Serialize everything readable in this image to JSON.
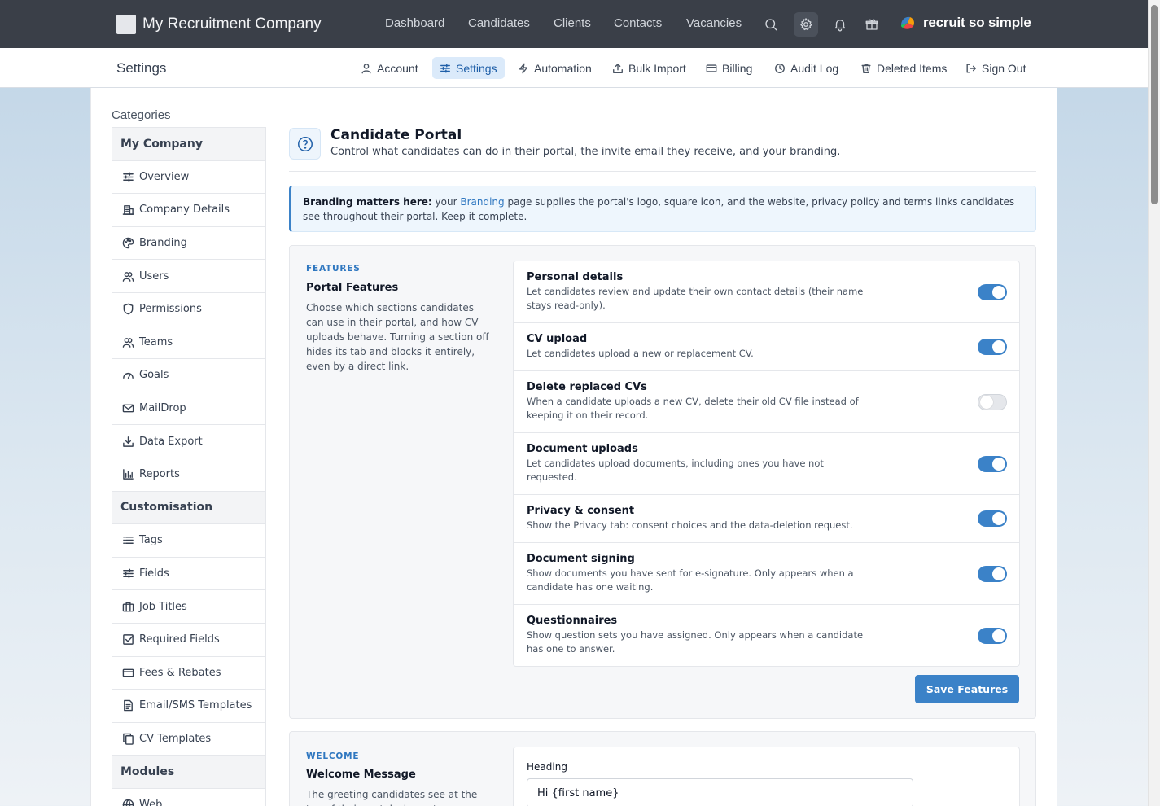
{
  "topbar": {
    "company_name": "My Recruitment Company",
    "nav": [
      "Dashboard",
      "Candidates",
      "Clients",
      "Contacts",
      "Vacancies"
    ],
    "brand_text": "recruit so simple"
  },
  "subbar": {
    "title": "Settings",
    "items": [
      {
        "label": "Account",
        "icon": "user-icon"
      },
      {
        "label": "Settings",
        "icon": "sliders-icon",
        "active": true
      },
      {
        "label": "Automation",
        "icon": "bolt-icon"
      },
      {
        "label": "Bulk Import",
        "icon": "upload-icon"
      },
      {
        "label": "Billing",
        "icon": "card-icon"
      },
      {
        "label": "Audit Log",
        "icon": "clock-icon"
      },
      {
        "label": "Deleted Items",
        "icon": "trash-icon"
      },
      {
        "label": "Sign Out",
        "icon": "sign-out-icon"
      }
    ]
  },
  "sidebar": {
    "categories_label": "Categories",
    "groups": [
      {
        "title": "My Company",
        "items": [
          "Overview",
          "Company Details",
          "Branding",
          "Users",
          "Permissions",
          "Teams",
          "Goals",
          "MailDrop",
          "Data Export",
          "Reports"
        ]
      },
      {
        "title": "Customisation",
        "items": [
          "Tags",
          "Fields",
          "Job Titles",
          "Required Fields",
          "Fees & Rebates",
          "Email/SMS Templates",
          "CV Templates"
        ]
      },
      {
        "title": "Modules",
        "items": [
          "Web"
        ]
      }
    ]
  },
  "header": {
    "title": "Candidate Portal",
    "subtitle": "Control what candidates can do in their portal, the invite email they receive, and your branding."
  },
  "notice": {
    "bold": "Branding matters here:",
    "pre": " your ",
    "link": "Branding",
    "post": " page supplies the portal's logo, square icon, and the website, privacy policy and terms links candidates see throughout their portal. Keep it complete."
  },
  "features": {
    "eyebrow": "FEATURES",
    "title": "Portal Features",
    "description": "Choose which sections candidates can use in their portal, and how CV uploads behave. Turning a section off hides its tab and blocks it entirely, even by a direct link.",
    "items": [
      {
        "title": "Personal details",
        "desc": "Let candidates review and update their own contact details (their name stays read-only).",
        "on": true
      },
      {
        "title": "CV upload",
        "desc": "Let candidates upload a new or replacement CV.",
        "on": true
      },
      {
        "title": "Delete replaced CVs",
        "desc": "When a candidate uploads a new CV, delete their old CV file instead of keeping it on their record.",
        "on": false
      },
      {
        "title": "Document uploads",
        "desc": "Let candidates upload documents, including ones you have not requested.",
        "on": true
      },
      {
        "title": "Privacy & consent",
        "desc": "Show the Privacy tab: consent choices and the data-deletion request.",
        "on": true
      },
      {
        "title": "Document signing",
        "desc": "Show documents you have sent for e-signature. Only appears when a candidate has one waiting.",
        "on": true
      },
      {
        "title": "Questionnaires",
        "desc": "Show question sets you have assigned. Only appears when a candidate has one to answer.",
        "on": true
      }
    ],
    "save_label": "Save Features"
  },
  "welcome": {
    "eyebrow": "WELCOME",
    "title": "Welcome Message",
    "description": "The greeting candidates see at the top of their portal, shown to every candidate.",
    "heading_label": "Heading",
    "heading_value": "Hi {first name}"
  },
  "colors": {
    "accent": "#3b82c8",
    "topbar": "#3a3f48"
  }
}
